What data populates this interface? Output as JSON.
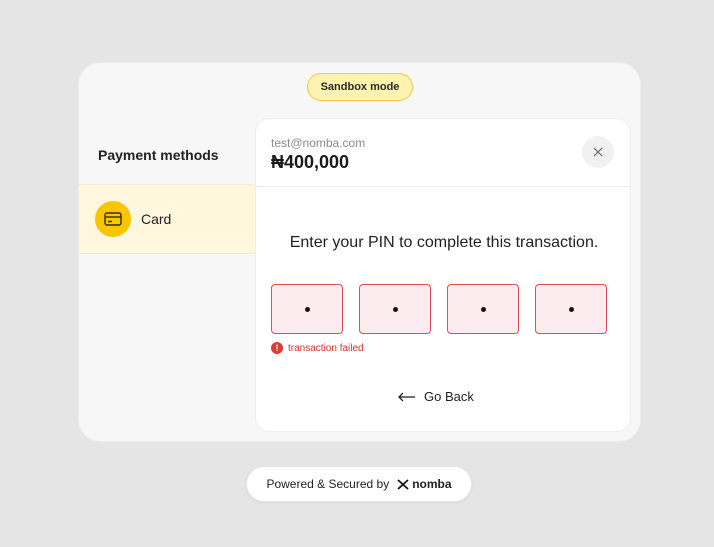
{
  "sandbox_badge": "Sandbox mode",
  "sidebar": {
    "title": "Payment methods",
    "items": [
      {
        "label": "Card",
        "icon": "credit-card-icon",
        "selected": true
      }
    ]
  },
  "header": {
    "email": "test@nomba.com",
    "amount": "₦400,000",
    "close_icon": "close-icon"
  },
  "pin": {
    "instruction": "Enter your PIN to complete this transaction.",
    "digits_entered": 4,
    "error_message": "transaction failed",
    "error_icon": "!"
  },
  "go_back_label": "Go Back",
  "footer": {
    "text": "Powered & Secured by",
    "brand": "nomba"
  },
  "colors": {
    "accent": "#f9c400",
    "error": "#e53935",
    "selected_bg": "#fef6dd"
  }
}
